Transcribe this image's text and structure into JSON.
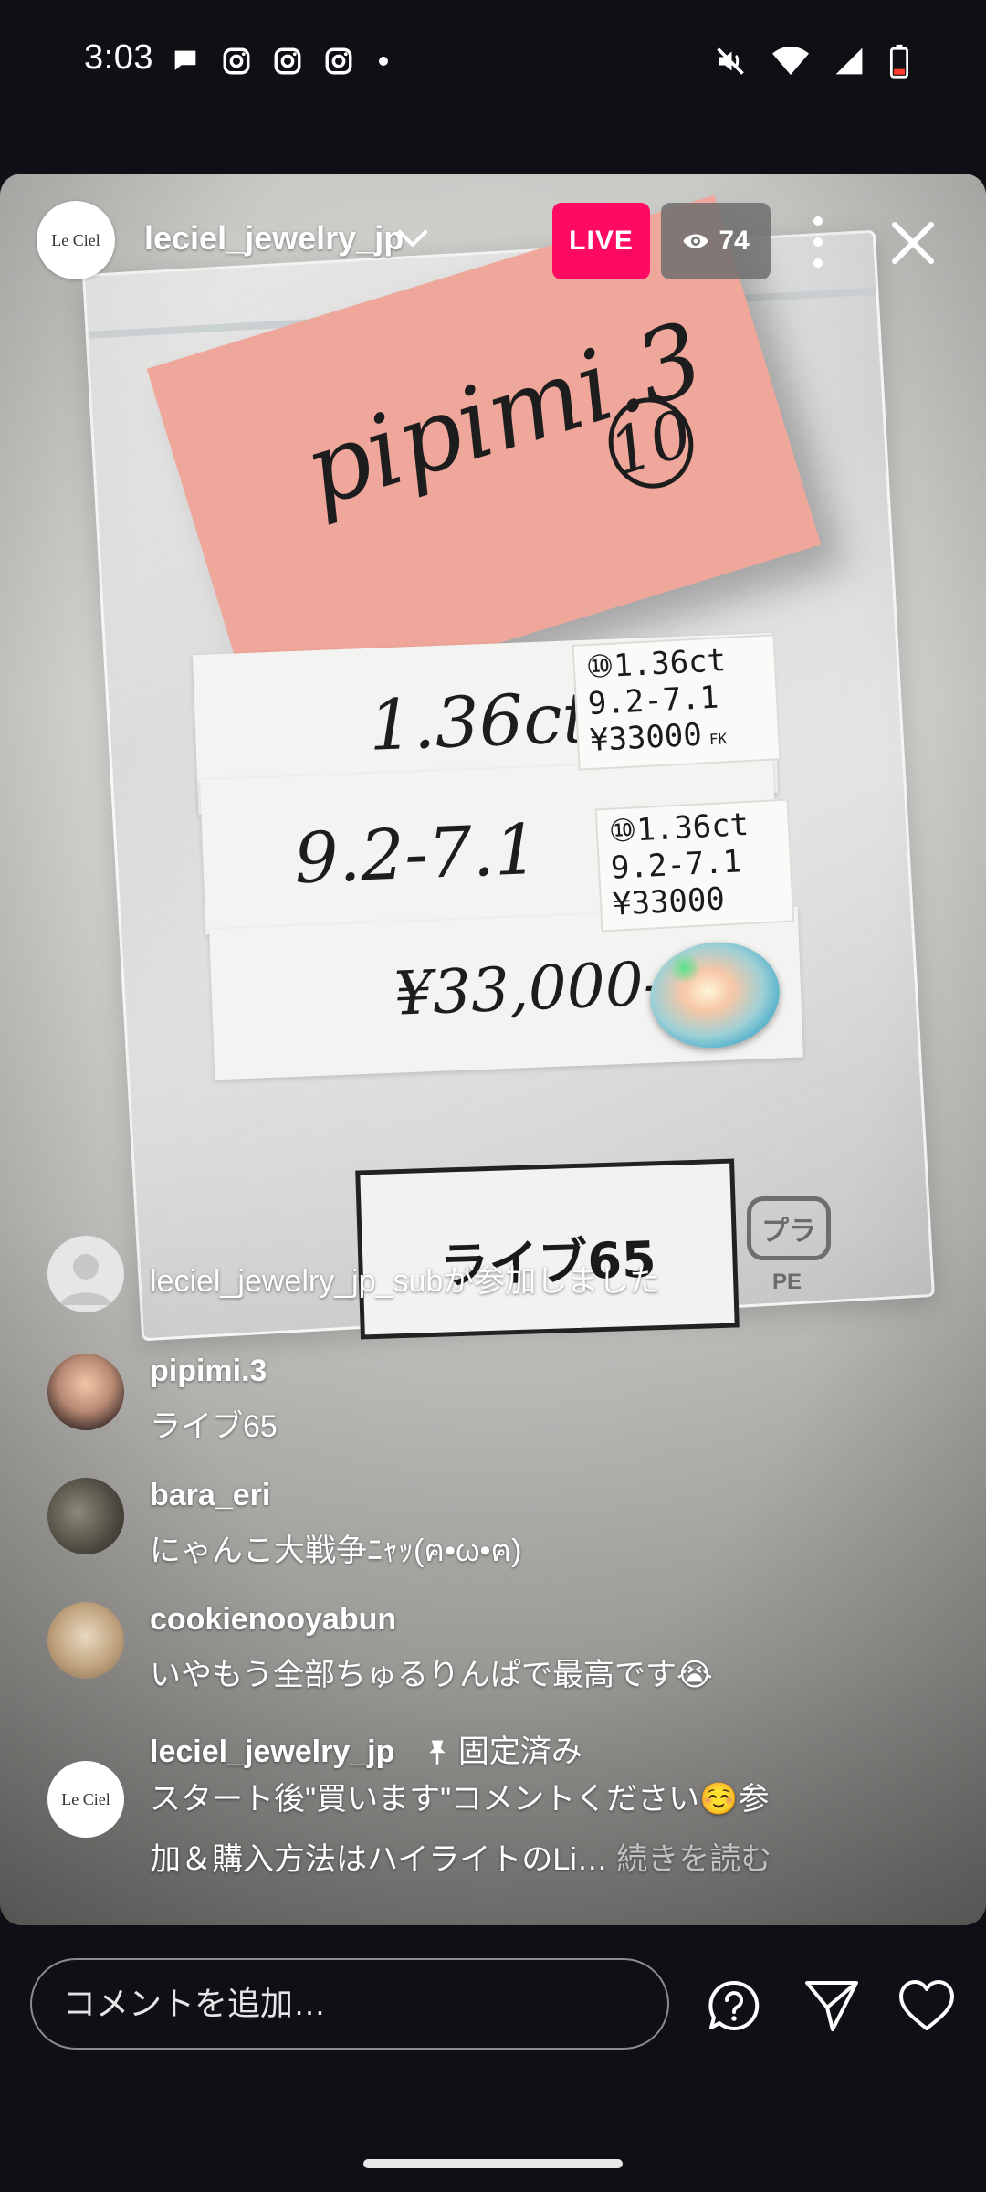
{
  "status_bar": {
    "time": "3:03",
    "left_icons": [
      "chat-bubble-icon",
      "instagram-icon",
      "instagram-icon",
      "instagram-icon",
      "dot-icon"
    ],
    "right_icons": [
      "mute-icon",
      "wifi-icon",
      "signal-icon",
      "battery-low-icon"
    ]
  },
  "live": {
    "host_username": "leciel_jewelry_jp",
    "host_avatar_text": "Le Ciel",
    "live_label": "LIVE",
    "viewer_count": "74"
  },
  "video_content": {
    "note_handwriting": "pipimi.3",
    "note_circle": "10",
    "card1_handwriting": "1.36ct",
    "card2_handwriting": "9.2-7.1",
    "card3_handwriting": "¥33,000-",
    "tag1_lines": [
      "⑩1.36ct",
      "9.2-7.1",
      "¥33000"
    ],
    "tag1_extra": "FK",
    "tag2_lines": [
      "⑩1.36ct",
      "9.2-7.1",
      "¥33000"
    ],
    "label_card": "ライブ65",
    "pe_mark": "PE",
    "pe_mark_symbol": "プラ"
  },
  "comments": [
    {
      "username": "",
      "text": "leciel_jewelry_jp_subが参加しました",
      "type": "join"
    },
    {
      "username": "pipimi.3",
      "text": "ライブ65"
    },
    {
      "username": "bara_eri",
      "text": "にゃんこ大戦争ﾆｬｯ(ฅ•ω•ฅ)"
    },
    {
      "username": "cookienooyabun",
      "text": "いやもう全部ちゅるりんぱで最高です😭"
    },
    {
      "username": "leciel_jewelry_jp",
      "pinned_label": "固定済み",
      "text_line1": "スタート後\"買います\"コメントください☺️参",
      "text_line2": "加＆購入方法はハイライトのLi…",
      "more": "続きを読む"
    }
  ],
  "bottom_bar": {
    "comment_placeholder": "コメントを追加…"
  },
  "colors": {
    "live_badge": "#ff0a63",
    "background": "#0e1015"
  }
}
